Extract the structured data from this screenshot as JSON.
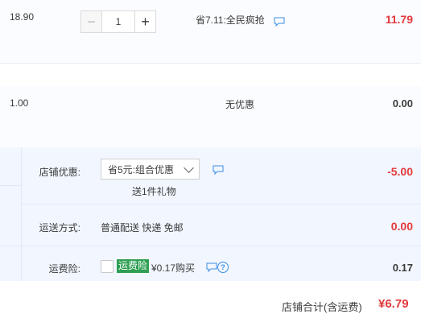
{
  "items": [
    {
      "price": "18.90",
      "quantity": "1",
      "minus_glyph": "−",
      "plus_glyph": "+",
      "promotion": "省7.11:全民疯抢",
      "amount": "11.79"
    },
    {
      "price": "1.00",
      "promotion": "无优惠",
      "amount": "0.00"
    }
  ],
  "shop": {
    "discount_label": "店铺优惠:",
    "discount_selected": "省5元:组合优惠",
    "gift_text": "送1件礼物",
    "discount_amount": "-5.00",
    "shipping_label": "运送方式:",
    "shipping_value": "普通配送 快递 免邮",
    "shipping_amount": "0.00",
    "insurance_label": "运费险:",
    "insurance_badge": "运费险",
    "insurance_price": "¥0.17购买",
    "insurance_amount": "0.17",
    "help_glyph": "?"
  },
  "total": {
    "label": "店铺合计(含运费)",
    "amount": "¥6.79"
  },
  "icons": {
    "chat": "chat-icon",
    "help": "question-icon",
    "chevron": "chevron-down-icon"
  },
  "colors": {
    "accent_red": "#e4393c",
    "insurance_green": "#2e9f52",
    "shop_background": "#f1f6ff",
    "icon_blue": "#3a8ee6"
  }
}
